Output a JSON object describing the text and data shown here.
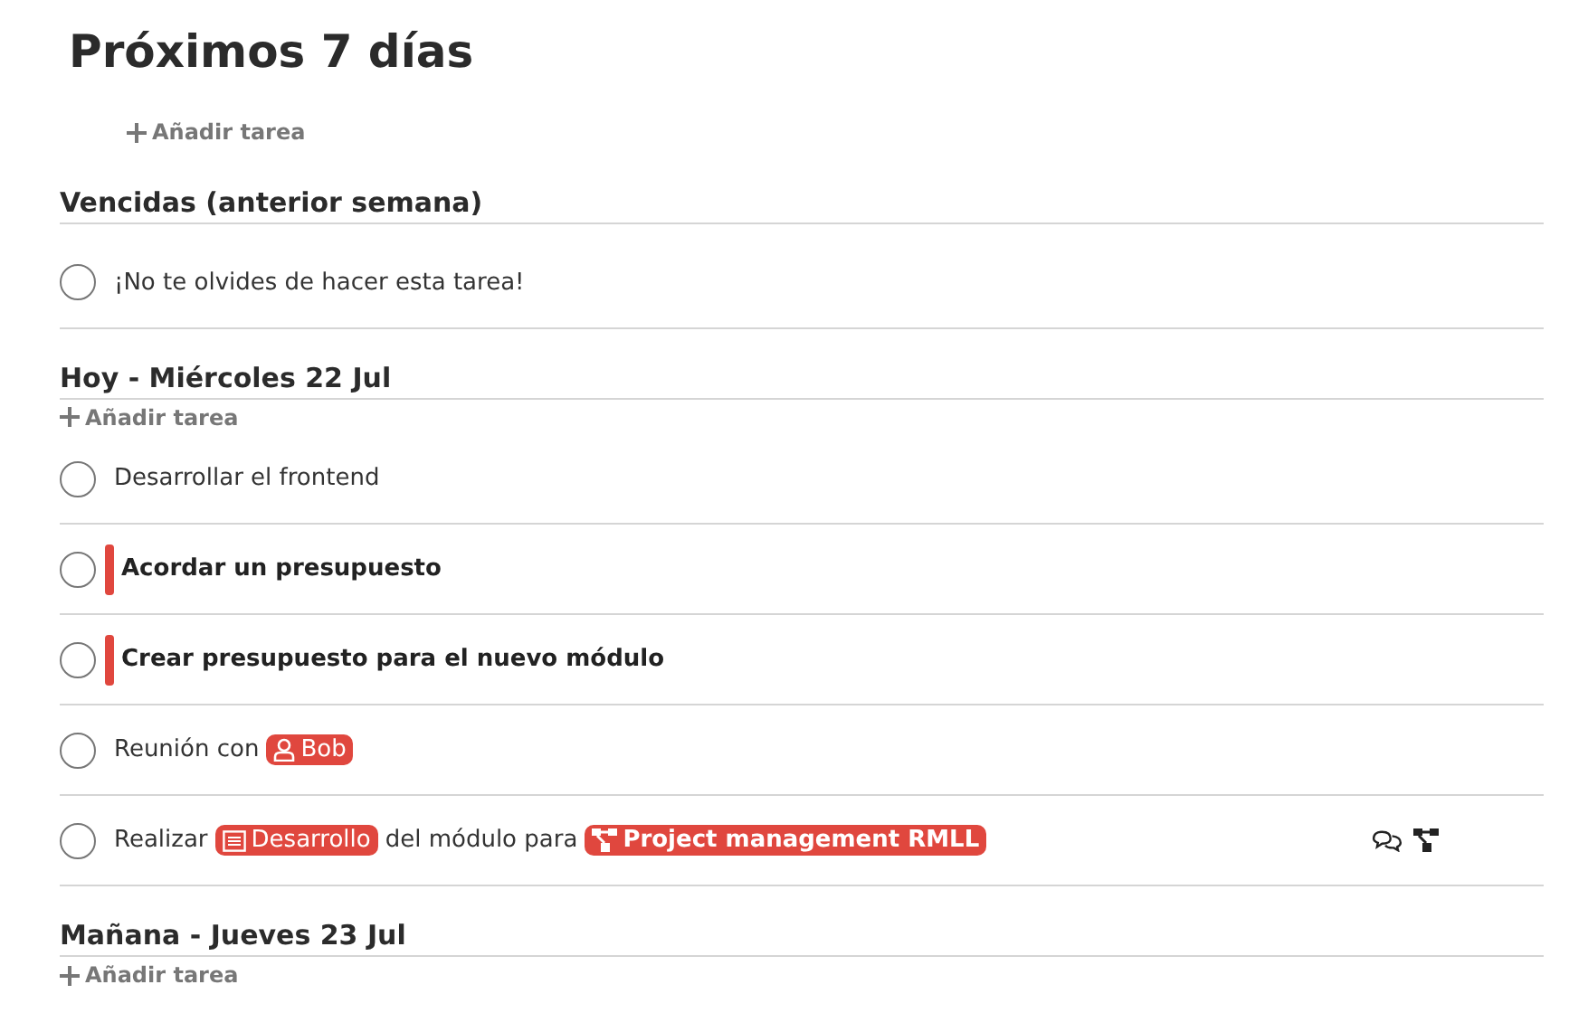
{
  "title": "Próximos 7 días",
  "top_add": {
    "label": "Añadir tarea"
  },
  "sections": [
    {
      "heading": "Vencidas (anterior semana)",
      "tasks": [
        {
          "checked": false,
          "priority": false,
          "parts": [
            {
              "kind": "text",
              "text": "¡No te olvides de hacer esta tarea!"
            }
          ]
        }
      ]
    },
    {
      "heading": "Hoy - Miércoles 22 Jul",
      "add_label": "Añadir tarea",
      "tasks": [
        {
          "checked": false,
          "priority": false,
          "parts": [
            {
              "kind": "text",
              "text": "Desarrollar el frontend"
            }
          ]
        },
        {
          "checked": false,
          "priority": true,
          "parts": [
            {
              "kind": "text",
              "text": "Acordar un presupuesto"
            }
          ]
        },
        {
          "checked": false,
          "priority": true,
          "parts": [
            {
              "kind": "text",
              "text": "Crear presupuesto para el nuevo módulo"
            }
          ]
        },
        {
          "checked": false,
          "priority": false,
          "parts": [
            {
              "kind": "text",
              "text": "Reunión con"
            },
            {
              "kind": "person",
              "text": "Bob"
            }
          ]
        },
        {
          "checked": false,
          "priority": false,
          "has_comments": true,
          "has_project": true,
          "parts": [
            {
              "kind": "text",
              "text": "Realizar"
            },
            {
              "kind": "category",
              "text": "Desarrollo"
            },
            {
              "kind": "text",
              "text": "del módulo para"
            },
            {
              "kind": "project",
              "text": "Project management RMLL"
            }
          ]
        }
      ]
    },
    {
      "heading": "Mañana - Jueves 23 Jul",
      "add_label": "Añadir tarea"
    }
  ]
}
